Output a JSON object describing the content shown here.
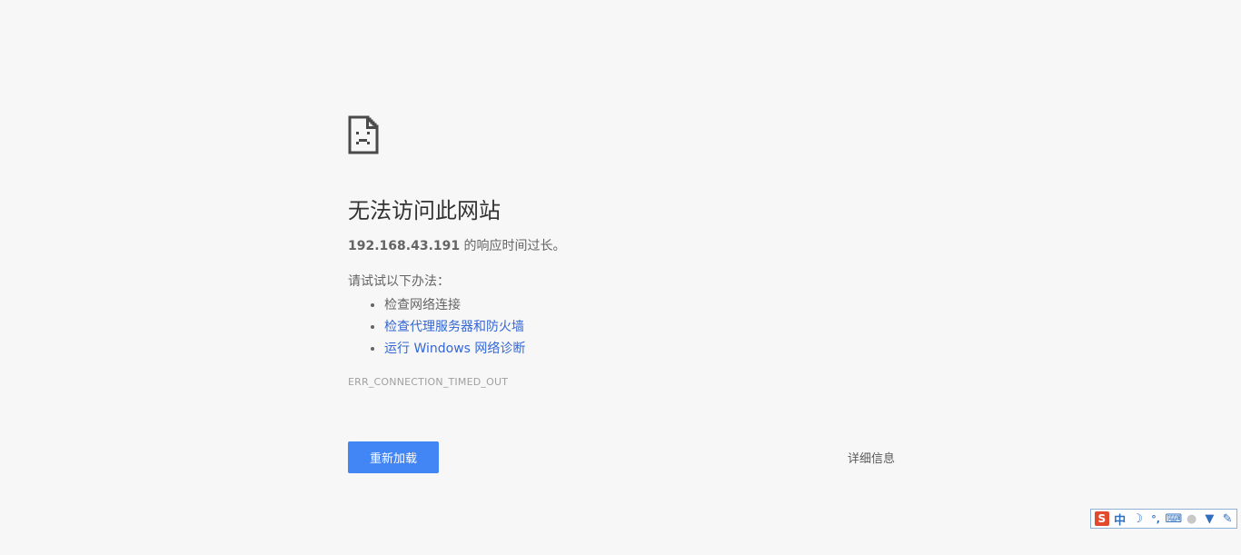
{
  "error_page": {
    "title": "无法访问此网站",
    "host": "192.168.43.191",
    "summary_suffix": " 的响应时间过长。",
    "suggest_heading": "请试试以下办法：",
    "suggestions": [
      {
        "text": "检查网络连接",
        "is_link": false
      },
      {
        "text": "检查代理服务器和防火墙",
        "is_link": true
      },
      {
        "text": "运行 Windows 网络诊断",
        "is_link": true
      }
    ],
    "error_code": "ERR_CONNECTION_TIMED_OUT",
    "reload_label": "重新加载",
    "details_label": "详细信息"
  },
  "ime_toolbar": {
    "logo": "S",
    "mode": "中",
    "moon": "☽",
    "punct": "°,",
    "keyboard": "⌨",
    "user": "●",
    "skin": "▼",
    "tools": "✎"
  },
  "colors": {
    "background": "#f7f7f7",
    "button_blue": "#4285f4",
    "link_blue": "#3367d6"
  }
}
